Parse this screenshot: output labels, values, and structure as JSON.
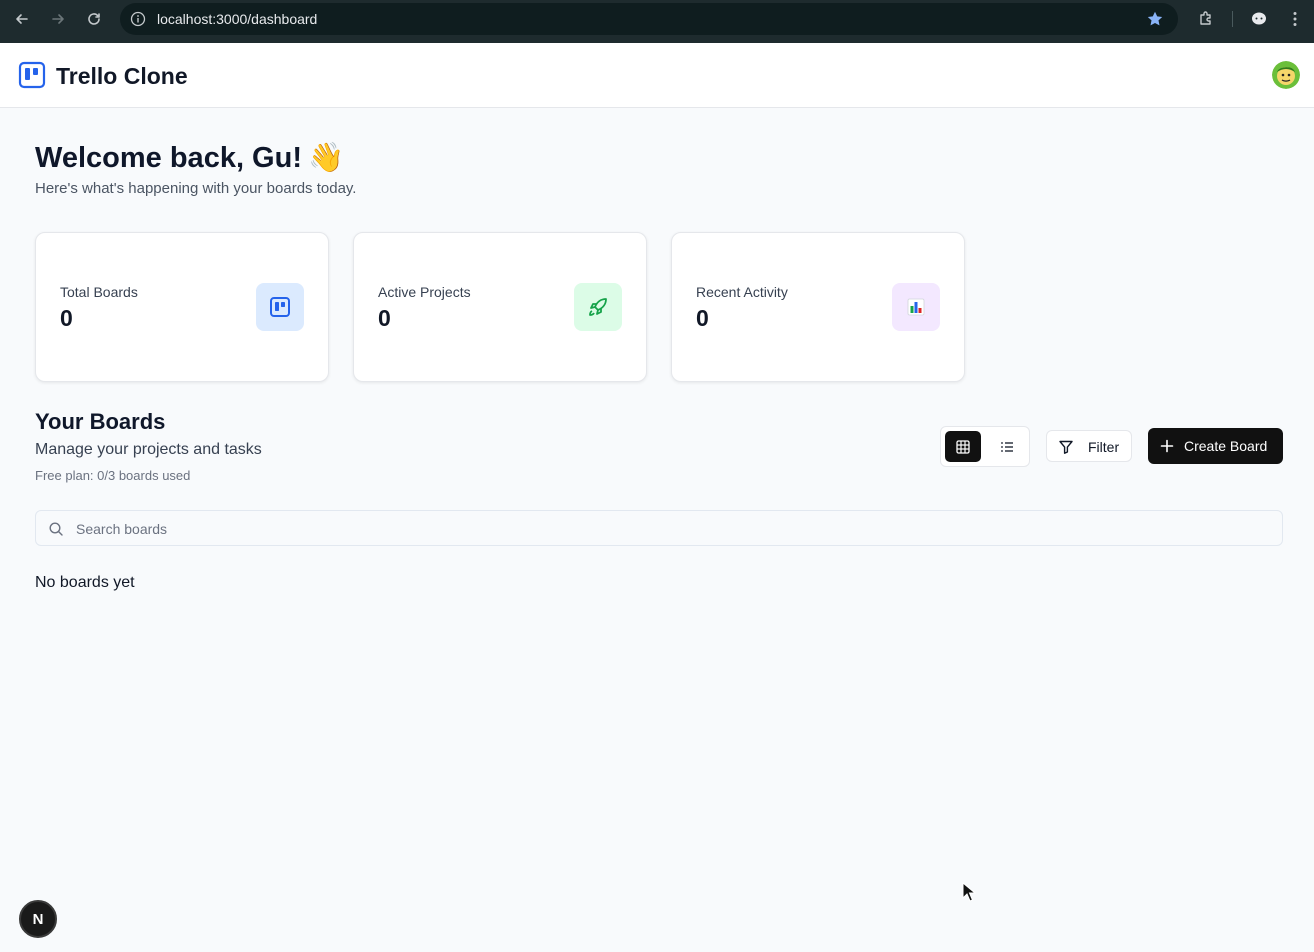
{
  "browser": {
    "url": "localhost:3000/dashboard"
  },
  "header": {
    "app_title": "Trello Clone"
  },
  "welcome": {
    "title": "Welcome back, Gu!",
    "emoji": "👋",
    "subtitle": "Here's what's happening with your boards today."
  },
  "stats": [
    {
      "label": "Total Boards",
      "value": "0",
      "icon": "trello-board-icon",
      "icon_bg": "#dbeafe",
      "icon_color": "#2563eb"
    },
    {
      "label": "Active Projects",
      "value": "0",
      "icon": "rocket-icon",
      "icon_bg": "#dcfce7",
      "icon_color": "#16a34a"
    },
    {
      "label": "Recent Activity",
      "value": "0",
      "icon": "bar-chart-icon",
      "icon_bg": "#f3e8ff",
      "icon_color": "#9333ea"
    }
  ],
  "boards": {
    "title": "Your Boards",
    "subtitle": "Manage your projects and tasks",
    "plan": "Free plan: 0/3 boards used",
    "filter_label": "Filter",
    "create_label": "Create Board",
    "search_placeholder": "Search boards",
    "empty": "No boards yet",
    "view_mode": "grid"
  },
  "dev": {
    "badge": "N"
  },
  "colors": {
    "brand": "#2563eb",
    "primary_button": "#111111",
    "chrome_bg": "#1e2b2e"
  }
}
